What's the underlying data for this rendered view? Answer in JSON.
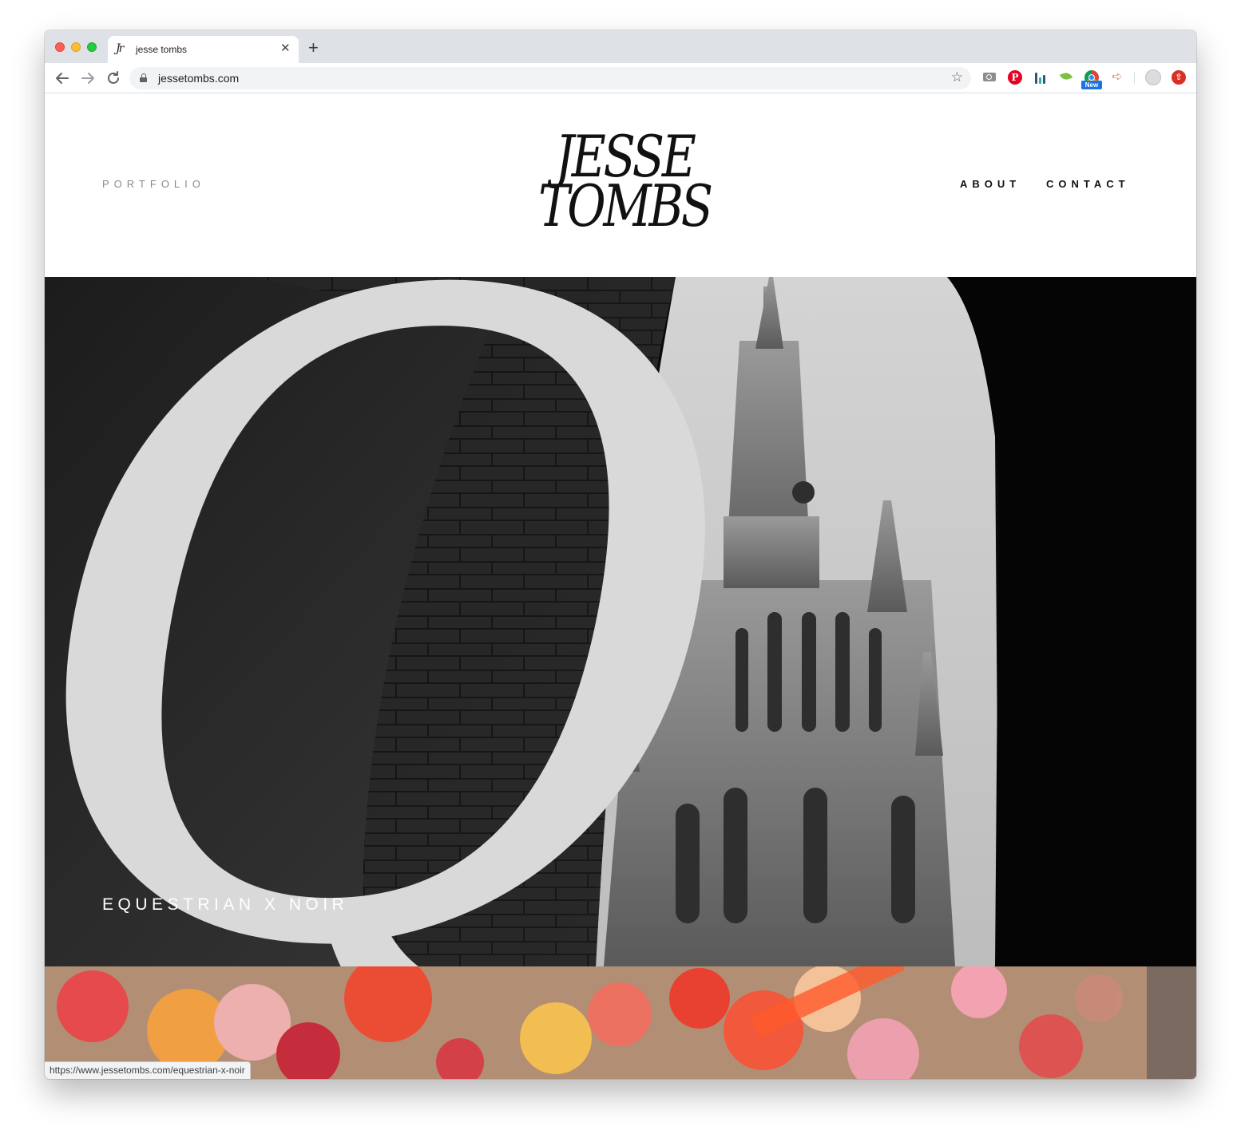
{
  "browser": {
    "tab": {
      "title": "jesse tombs",
      "favicon": "Jr",
      "close_glyph": "✕"
    },
    "new_tab_glyph": "+",
    "url": "jessetombs.com",
    "extensions": {
      "new_badge": "New",
      "pinterest_glyph": "P"
    },
    "status_url": "https://www.jessetombs.com/equestrian-x-noir"
  },
  "site": {
    "nav": {
      "portfolio": "PORTFOLIO",
      "about": "ABOUT",
      "contact": "CONTACT"
    },
    "logo": {
      "line1": "JESSE",
      "line2": "TOMBS"
    },
    "hero": {
      "title": "EQUESTRIAN X NOIR"
    }
  },
  "colors": {
    "accent_text": "#111111",
    "muted_nav": "#8a8a8a",
    "hero_letter": "#d9d9d9",
    "pinterest": "#e60023",
    "chrome_blue": "#1a73e8"
  },
  "icons": [
    "back-arrow-icon",
    "forward-arrow-icon",
    "reload-icon",
    "lock-icon",
    "star-icon",
    "camera-icon",
    "pinterest-icon",
    "bars-icon",
    "leaf-icon",
    "chrome-icon",
    "arrow-right-icon",
    "profile-icon",
    "update-icon"
  ]
}
